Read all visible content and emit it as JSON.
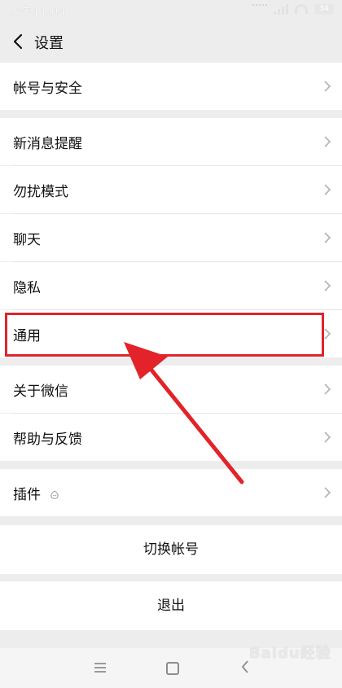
{
  "status": {
    "time": "上午11:04",
    "battery": "34"
  },
  "header": {
    "title": "设置"
  },
  "rows": [
    {
      "label": "帐号与安全"
    },
    {
      "label": "新消息提醒"
    },
    {
      "label": "勿扰模式"
    },
    {
      "label": "聊天"
    },
    {
      "label": "隐私"
    },
    {
      "label": "通用"
    },
    {
      "label": "关于微信"
    },
    {
      "label": "帮助与反馈"
    },
    {
      "label": "插件"
    }
  ],
  "actions": {
    "switch_account": "切换帐号",
    "logout": "退出"
  },
  "watermark": "Baidu经验",
  "colors": {
    "highlight": "#e2232a",
    "background": "#ededed"
  }
}
